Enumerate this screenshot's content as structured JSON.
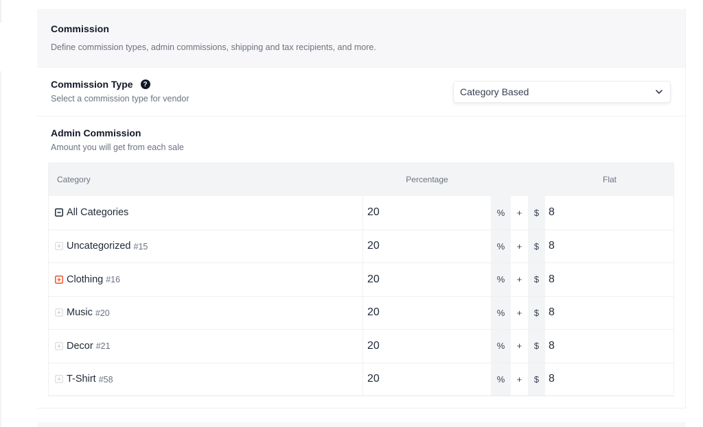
{
  "section": {
    "title": "Commission",
    "description": "Define commission types, admin commissions, shipping and tax recipients, and more."
  },
  "commission_type": {
    "title": "Commission Type",
    "help_icon": "question-circle-icon",
    "description": "Select a commission type for vendor",
    "selected": "Category Based"
  },
  "admin_commission": {
    "title": "Admin Commission",
    "description": "Amount you will get from each sale",
    "columns": [
      "Category",
      "Percentage",
      "Flat"
    ],
    "percent_symbol": "%",
    "plus_symbol": "+",
    "currency_symbol": "$",
    "rows": [
      {
        "name": "All Categories",
        "id": "",
        "icon": "collapse-minus-icon",
        "percentage": "20",
        "flat": "8"
      },
      {
        "name": "Uncategorized",
        "id": "#15",
        "icon": "expand-plus-icon",
        "percentage": "20",
        "flat": "8"
      },
      {
        "name": "Clothing",
        "id": "#16",
        "icon": "expand-plus-icon-active",
        "percentage": "20",
        "flat": "8"
      },
      {
        "name": "Music",
        "id": "#20",
        "icon": "expand-plus-icon",
        "percentage": "20",
        "flat": "8"
      },
      {
        "name": "Decor",
        "id": "#21",
        "icon": "expand-plus-icon",
        "percentage": "20",
        "flat": "8"
      },
      {
        "name": "T-Shirt",
        "id": "#58",
        "icon": "expand-plus-icon",
        "percentage": "20",
        "flat": "8"
      }
    ]
  },
  "colors": {
    "accent": "#f0562e",
    "header_bg": "#f7f7f9",
    "table_header_bg": "#f3f4f6"
  }
}
